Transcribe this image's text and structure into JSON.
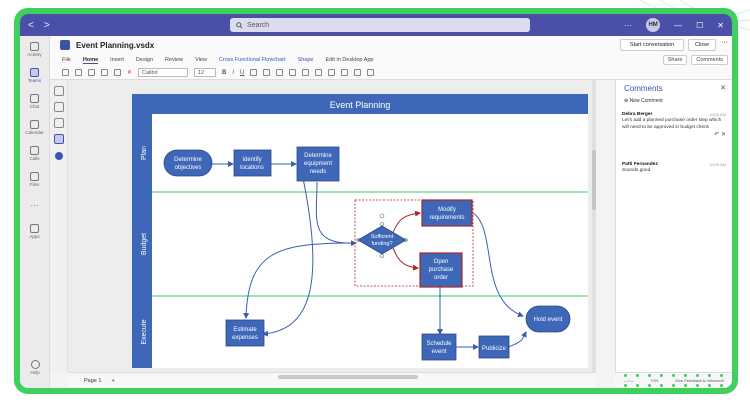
{
  "titlebar": {
    "back": "<",
    "forward": ">",
    "search_placeholder": "Search",
    "avatar": "HM",
    "more": "···"
  },
  "rail": [
    {
      "label": "Activity",
      "active": false
    },
    {
      "label": "Teams",
      "active": true
    },
    {
      "label": "Chat",
      "active": false
    },
    {
      "label": "Calendar",
      "active": false
    },
    {
      "label": "Calls",
      "active": false
    },
    {
      "label": "Files",
      "active": false
    },
    {
      "label": "···",
      "active": false
    },
    {
      "label": "Apps",
      "active": false
    }
  ],
  "rail_help": "Help",
  "file": {
    "name": "Event Planning.vsdx",
    "start_conversation": "Start conversation",
    "close": "Close",
    "more": "···"
  },
  "tabs": {
    "items": [
      "File",
      "Home",
      "Insert",
      "Design",
      "Review",
      "View",
      "Cross Functional Flowchart",
      "Shape",
      "Edit in Desktop App"
    ],
    "active": "Home",
    "share": "Share",
    "comments": "Comments"
  },
  "toolbar": {
    "font": "Calibri",
    "size": "12",
    "bold": "B",
    "italic": "I",
    "underline": "U"
  },
  "diagram": {
    "title": "Event Planning",
    "lanes": [
      "Plan",
      "Budget",
      "Execute"
    ],
    "shapes": {
      "determine_objectives": [
        "Determine",
        "objectives"
      ],
      "identify_locations": [
        "Identify",
        "locations"
      ],
      "determine_equipment": [
        "Determine",
        "equipment",
        "needs"
      ],
      "sufficient_funding": [
        "Sufficient",
        "funding?"
      ],
      "modify_requirements": [
        "Modify",
        "requirements"
      ],
      "open_purchase_order": [
        "Open",
        "purchase",
        "order"
      ],
      "estimate_expenses": [
        "Estimate",
        "expenses"
      ],
      "schedule_event": [
        "Schedule",
        "event"
      ],
      "publicize": [
        "Publicize"
      ],
      "hold_event": [
        "Hold event"
      ]
    }
  },
  "pagebar": {
    "page": "Page 1",
    "add": "+"
  },
  "comments": {
    "title": "Comments",
    "new_comment": "New Comment",
    "threads": [
      {
        "author": "Debra Berger",
        "time": "10/26 AM",
        "text": "Let's add a planned purchase order step which will need to be approved in budget check"
      },
      {
        "author": "Patti Fernandez",
        "time": "10/26 AM",
        "text": "Sounds good."
      }
    ]
  },
  "status": {
    "zoom": "74%",
    "feedback": "Give Feedback to Microsoft"
  }
}
